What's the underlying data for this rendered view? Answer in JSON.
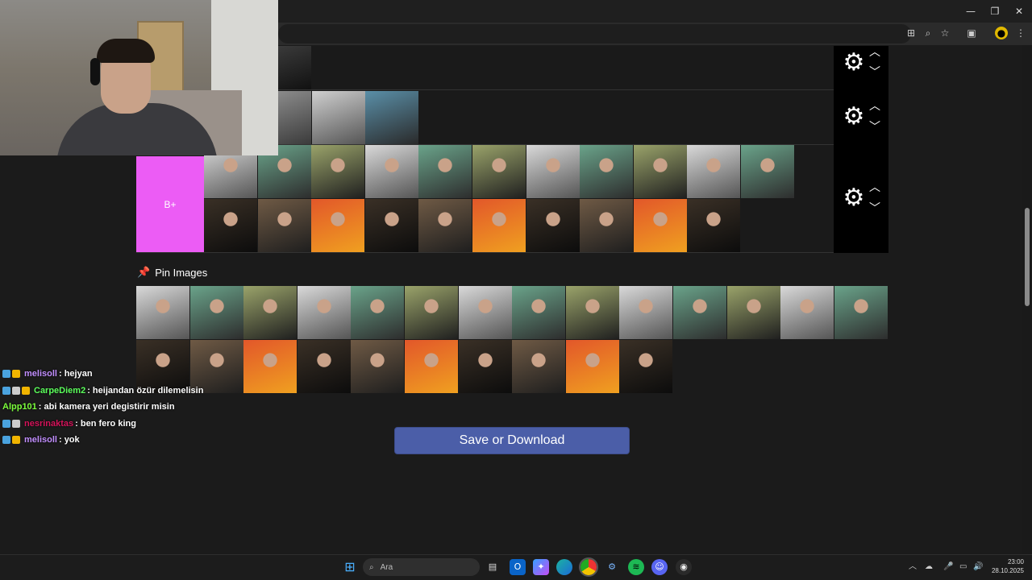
{
  "window": {
    "controls": {
      "minimize": "—",
      "maximize": "❐",
      "close": "✕"
    }
  },
  "toolbar": {
    "icons": [
      "translate-icon",
      "zoom-icon",
      "bookmark-star-icon",
      "extensions-icon",
      "profile-icon",
      "menu-icon"
    ]
  },
  "tiers": [
    {
      "label": "",
      "images": 1
    },
    {
      "label": "",
      "images": 3
    },
    {
      "label": "B+",
      "color": "#ec5cf5",
      "images": 21
    }
  ],
  "pin": {
    "title": "Pin Images",
    "images": 24
  },
  "save_button": {
    "label": "Save or Download"
  },
  "chat": [
    {
      "user": "melisoll",
      "color": "#c28fff",
      "badges": [
        "#4aa3df",
        "#f0b400"
      ],
      "message": ": hejyan"
    },
    {
      "user": "CarpeDiem2",
      "color": "#5cff5c",
      "badges": [
        "#4aa3df",
        "#cccccc",
        "#f0b400"
      ],
      "message": ": heijandan özür dilemelisin"
    },
    {
      "user": "Alpp101",
      "color": "#7cff3c",
      "badges": [],
      "message": ": abi kamera yeri degistirir misin"
    },
    {
      "user": "nesrinaktas",
      "color": "#d4145a",
      "badges": [
        "#4aa3df",
        "#cccccc"
      ],
      "message": ": ben fero king"
    },
    {
      "user": "melisoll",
      "color": "#c28fff",
      "badges": [
        "#4aa3df",
        "#f0b400"
      ],
      "message": ": yok"
    }
  ],
  "taskbar": {
    "search_placeholder": "Ara",
    "time": "23:00",
    "date": "28.10.2025",
    "apps": [
      "windows-start-icon",
      "file-explorer-icon",
      "outlook-icon",
      "copilot-icon",
      "edge-icon",
      "chrome-icon",
      "settings-icon",
      "spotify-icon",
      "discord-icon",
      "steam-icon"
    ]
  },
  "colors": {
    "accent_button": "#4b5ea8",
    "tier_b_plus": "#ec5cf5",
    "background": "#1b1b1b"
  }
}
